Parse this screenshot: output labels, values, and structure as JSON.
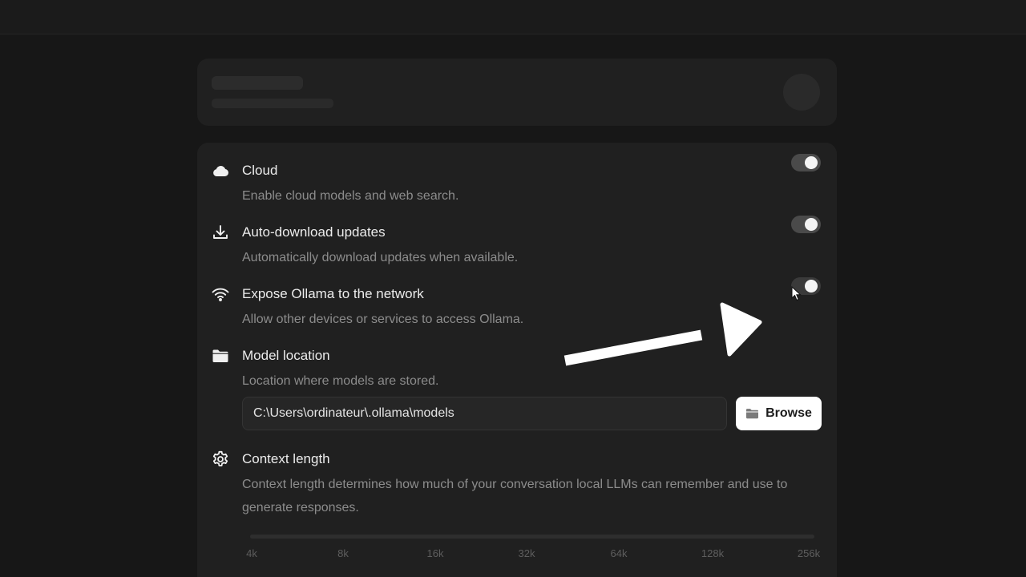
{
  "settings": {
    "cloud": {
      "title": "Cloud",
      "description": "Enable cloud models and web search.",
      "icon": "cloud-icon",
      "enabled": true
    },
    "auto_download": {
      "title": "Auto-download updates",
      "description": "Automatically download updates when available.",
      "icon": "download-icon",
      "enabled": true
    },
    "expose_network": {
      "title": "Expose Ollama to the network",
      "description": "Allow other devices or services to access Ollama.",
      "icon": "wifi-icon",
      "enabled": true
    },
    "model_location": {
      "title": "Model location",
      "description": "Location where models are stored.",
      "icon": "folder-icon",
      "path": "C:\\Users\\ordinateur\\.ollama\\models",
      "browse_label": "Browse"
    },
    "context_length": {
      "title": "Context length",
      "description": "Context length determines how much of your conversation local LLMs can remember and use to generate responses.",
      "icon": "gear-icon",
      "ticks": [
        "4k",
        "8k",
        "16k",
        "32k",
        "64k",
        "128k",
        "256k"
      ]
    }
  },
  "colors": {
    "background": "#171717",
    "card": "#202020",
    "toggle_on": "#4a4a4a",
    "button": "#ffffff"
  }
}
